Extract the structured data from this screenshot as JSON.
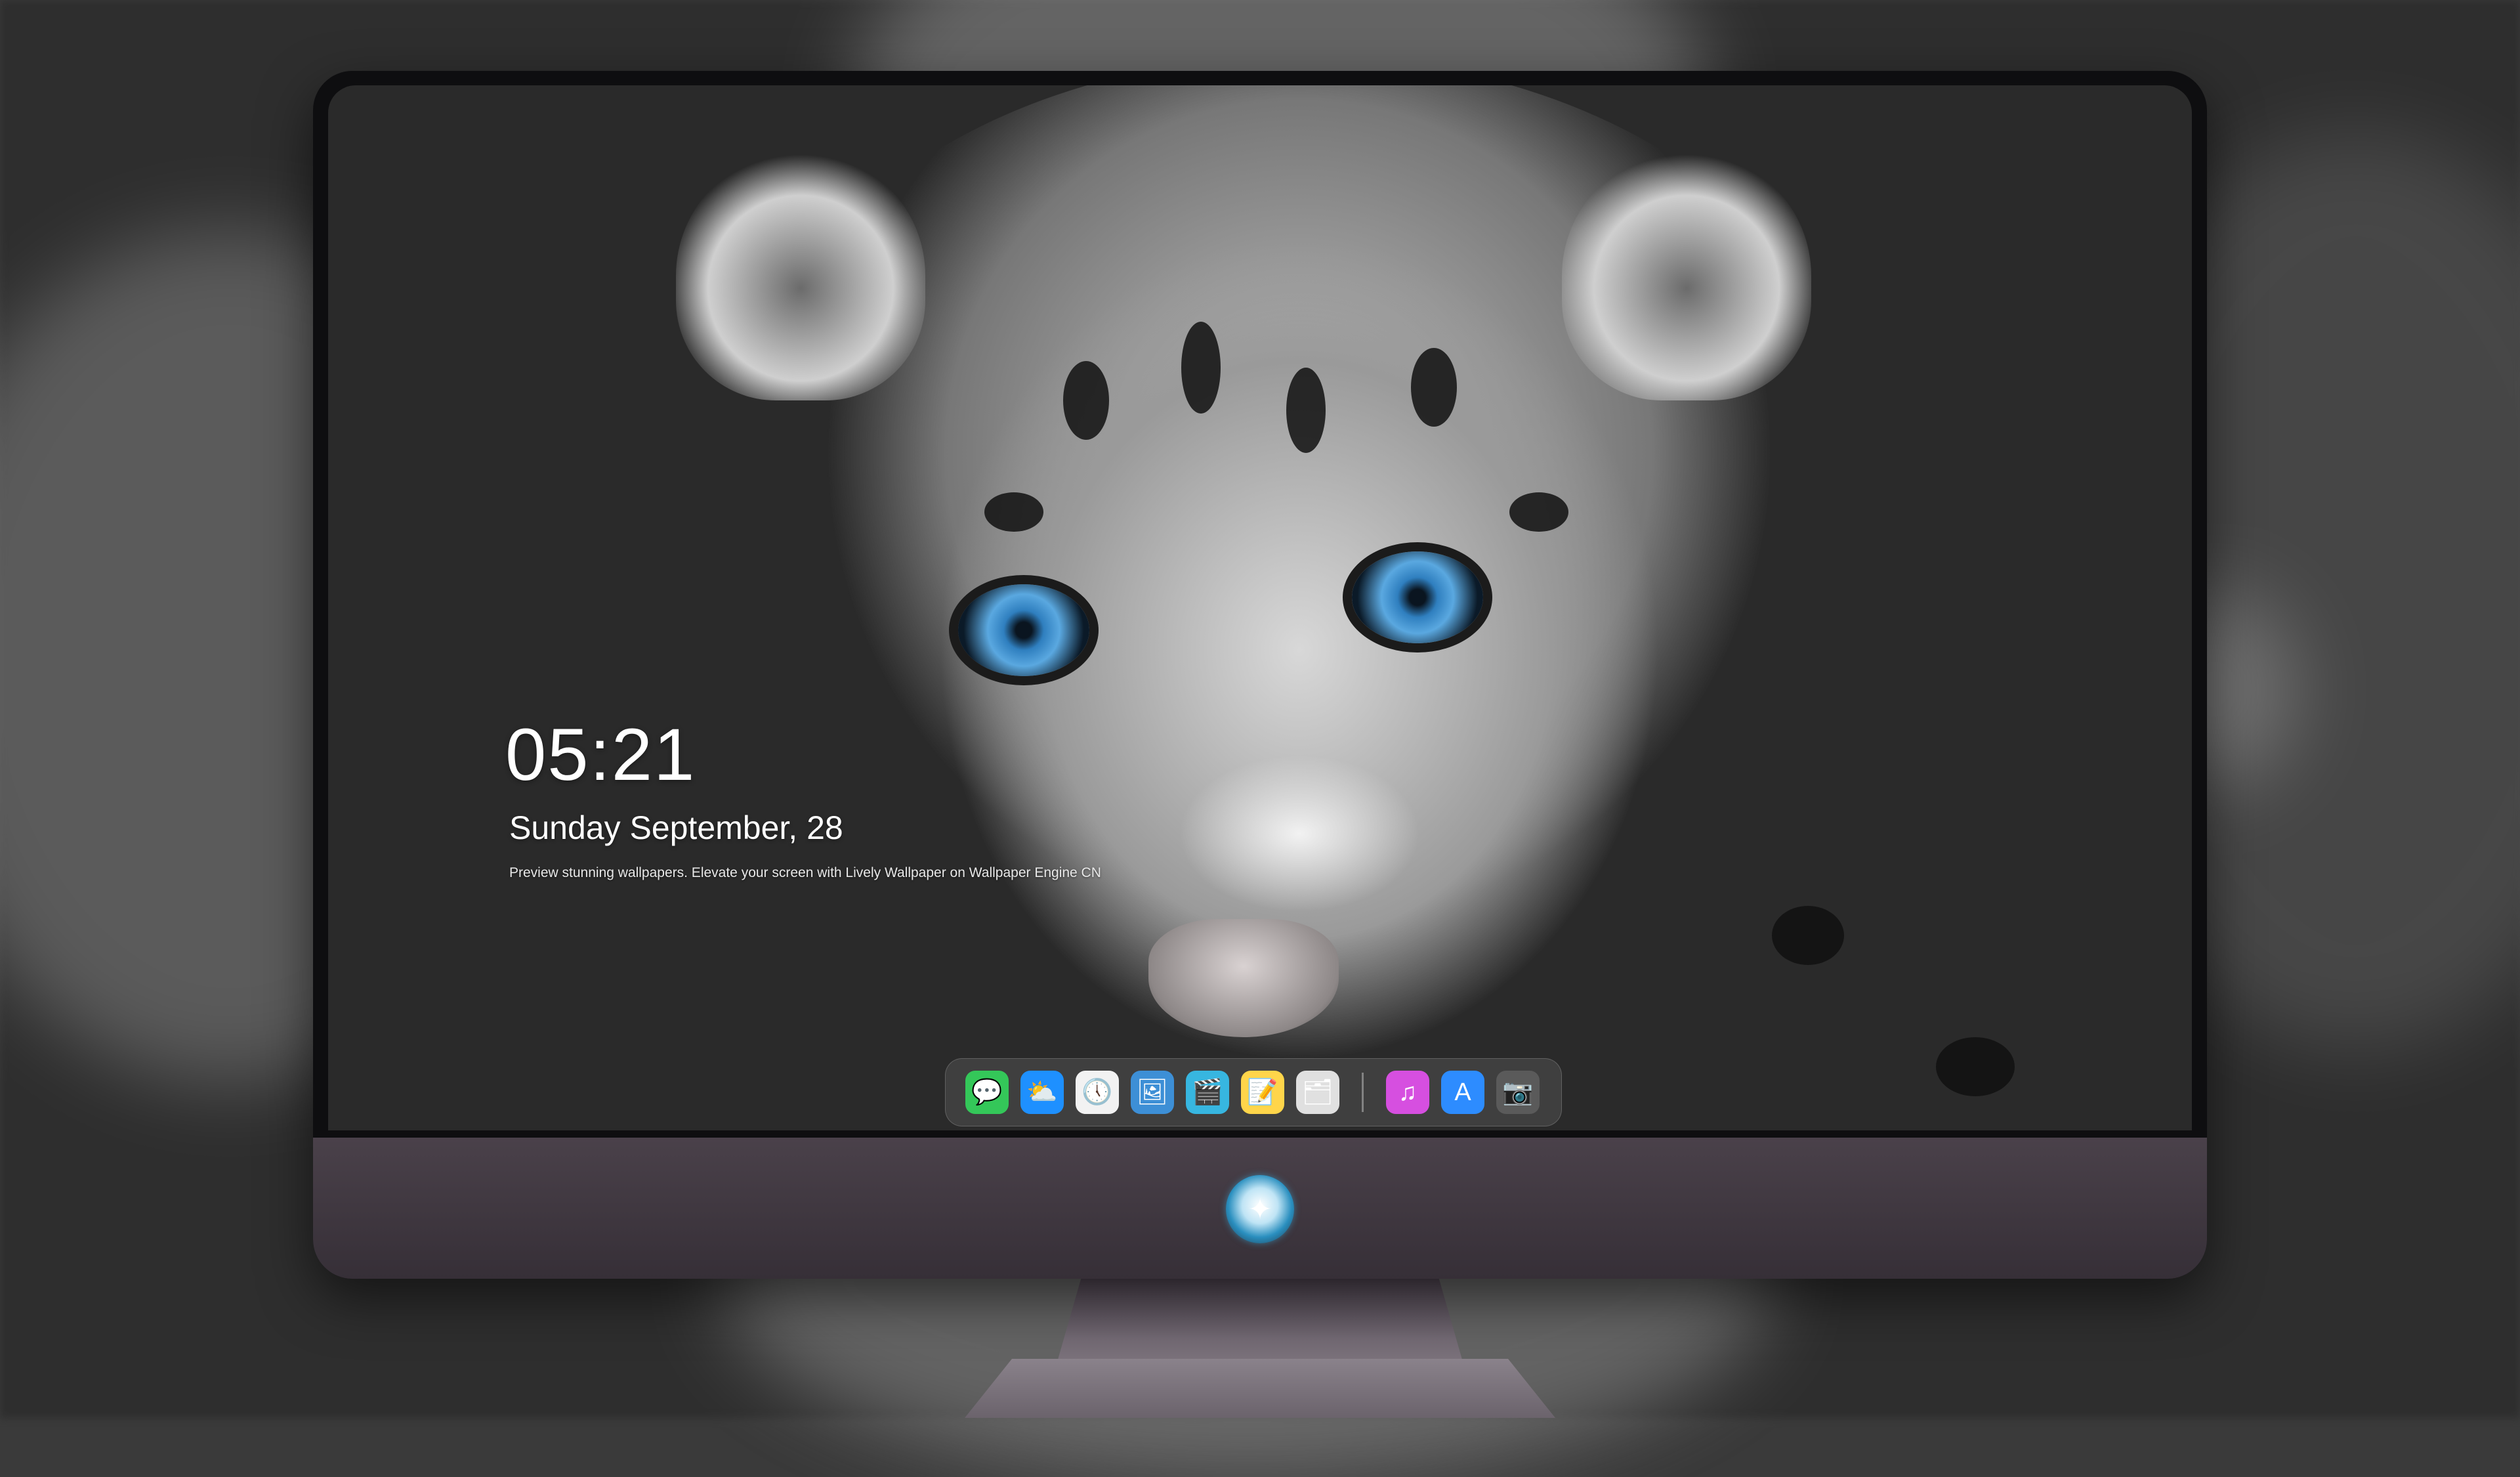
{
  "lock_screen": {
    "time": "05:21",
    "date": "Sunday September, 28",
    "caption": "Preview stunning wallpapers. Elevate your screen with  Lively Wallpaper on Wallpaper Engine CN"
  },
  "dock": {
    "apps": [
      {
        "name": "messages",
        "icon": "💬",
        "color": "#34c759"
      },
      {
        "name": "weather",
        "icon": "⛅",
        "color": "#1e90ff"
      },
      {
        "name": "clock",
        "icon": "🕔",
        "color": "#f2f2f2"
      },
      {
        "name": "preview",
        "icon": "🖼",
        "color": "#3d8fd6"
      },
      {
        "name": "final-cut",
        "icon": "🎬",
        "color": "#37b6e0"
      },
      {
        "name": "notes",
        "icon": "📝",
        "color": "#ffd54a"
      },
      {
        "name": "photo-booth",
        "icon": "🗂",
        "color": "#e0e0e0"
      }
    ],
    "pinned": [
      {
        "name": "music",
        "icon": "♫",
        "color": "#d64fe0"
      },
      {
        "name": "app-store",
        "icon": "A",
        "color": "#2d8cff"
      },
      {
        "name": "camera",
        "icon": "📷",
        "color": "#5a5a5a"
      }
    ]
  }
}
